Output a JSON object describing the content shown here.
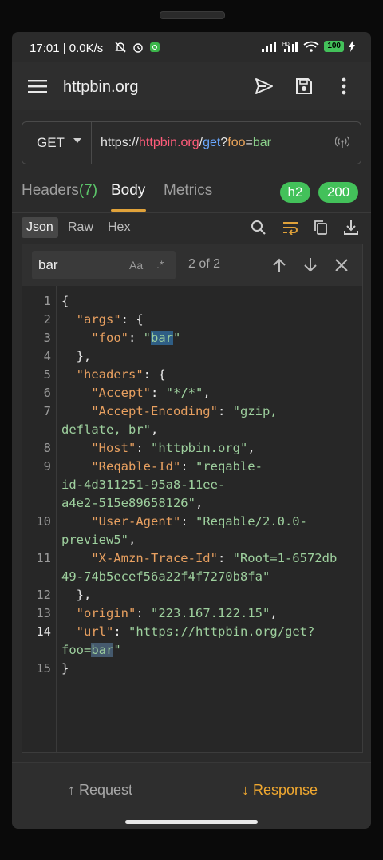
{
  "status_bar": {
    "time": "17:01",
    "network_speed": "0.0K/s",
    "battery": "100"
  },
  "app_bar": {
    "title": "httpbin.org"
  },
  "request": {
    "method": "GET",
    "url_scheme": "https://",
    "url_host": "httpbin.org",
    "url_slash": "/",
    "url_path": "get",
    "url_q": "?",
    "url_key": "foo",
    "url_eq": "=",
    "url_val": "bar"
  },
  "tabs": {
    "headers_label": "Headers",
    "headers_count": "(7)",
    "body_label": "Body",
    "metrics_label": "Metrics",
    "protocol_badge": "h2",
    "status_badge": "200"
  },
  "formats": {
    "json": "Json",
    "raw": "Raw",
    "hex": "Hex"
  },
  "search": {
    "value": "bar",
    "case_toggle": "Aa",
    "regex_toggle": ".*",
    "match_count": "2 of 2"
  },
  "code_lines": [
    {
      "num": "1"
    },
    {
      "num": "2"
    },
    {
      "num": "3"
    },
    {
      "num": "4"
    },
    {
      "num": "5"
    },
    {
      "num": "6"
    },
    {
      "num": "7"
    },
    {
      "num": "8"
    },
    {
      "num": "9"
    },
    {
      "num": "10"
    },
    {
      "num": "11"
    },
    {
      "num": "12"
    },
    {
      "num": "13"
    },
    {
      "num": "14"
    },
    {
      "num": "15"
    }
  ],
  "code": {
    "l1": "{",
    "args_key": "\"args\"",
    "foo_key": "\"foo\"",
    "foo_val": "bar",
    "l4": "},",
    "headers_key": "\"headers\"",
    "accept_key": "\"Accept\"",
    "accept_val": "\"*/*\"",
    "ae_key": "\"Accept-Encoding\"",
    "ae_val_1": "\"gzip,",
    "ae_val_2": "deflate, br\"",
    "host_key": "\"Host\"",
    "host_val": "\"httpbin.org\"",
    "rid_key": "\"Reqable-Id\"",
    "rid_val_1": "\"reqable-",
    "rid_val_2": "id-4d311251-95a8-11ee-",
    "rid_val_3": "a4e2-515e89658126\"",
    "ua_key": "\"User-Agent\"",
    "ua_val_1": "\"Reqable/2.0.0-",
    "ua_val_2": "preview5\"",
    "xa_key": "\"X-Amzn-Trace-Id\"",
    "xa_val_1": "\"Root=1-6572db",
    "xa_val_2": "49-74b5ecef56a22f4f7270b8fa\"",
    "l12": "},",
    "origin_key": "\"origin\"",
    "origin_val": "\"223.167.122.15\"",
    "url_key": "\"url\"",
    "url_val_1": "\"https://httpbin.org/get?",
    "url_val_2a": "foo=",
    "url_val_2b": "bar",
    "url_val_2c": "\"",
    "l15": "}"
  },
  "bottom": {
    "request": "↑ Request",
    "response": "↓ Response"
  },
  "colors": {
    "accent": "#e0a23a",
    "badge_green": "#43c15a",
    "json_key": "#e8a060",
    "json_string": "#9ed09e",
    "url_host": "#ff5c7a",
    "url_path": "#6aa8ff"
  }
}
